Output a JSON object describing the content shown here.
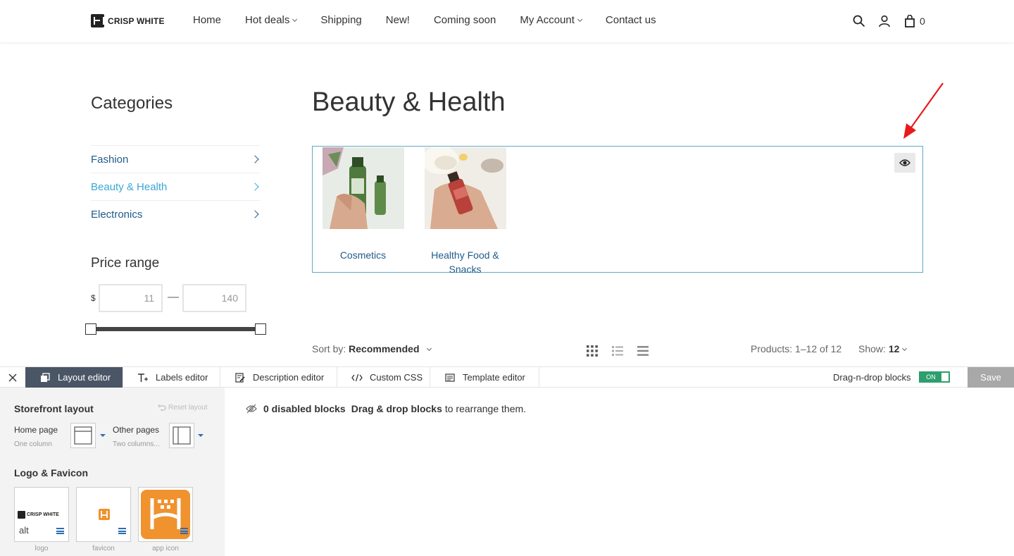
{
  "header": {
    "logo_text": "CRISP WHITE",
    "nav": [
      {
        "label": "Home",
        "dropdown": false
      },
      {
        "label": "Hot deals",
        "dropdown": true
      },
      {
        "label": "Shipping",
        "dropdown": false
      },
      {
        "label": "New!",
        "dropdown": false
      },
      {
        "label": "Coming soon",
        "dropdown": false
      },
      {
        "label": "My Account",
        "dropdown": true
      },
      {
        "label": "Contact us",
        "dropdown": false
      }
    ],
    "cart_count": "0"
  },
  "sidebar": {
    "categories_title": "Categories",
    "categories": [
      {
        "label": "Fashion",
        "active": false
      },
      {
        "label": "Beauty & Health",
        "active": true
      },
      {
        "label": "Electronics",
        "active": false
      }
    ],
    "price_title": "Price range",
    "currency": "$",
    "price_min": "11",
    "price_max": "140",
    "dash": "—"
  },
  "main": {
    "title": "Beauty & Health",
    "subcategories": [
      {
        "label": "Cosmetics"
      },
      {
        "label": "Healthy Food & Snacks"
      }
    ],
    "sort_label": "Sort by:",
    "sort_value": "Recommended",
    "products_count": "Products: 1–12 of 12",
    "show_label": "Show:",
    "show_value": "12"
  },
  "editor": {
    "tabs": [
      {
        "label": "Layout editor",
        "icon": "layout-icon",
        "active": true
      },
      {
        "label": "Labels editor",
        "icon": "text-icon",
        "active": false
      },
      {
        "label": "Description editor",
        "icon": "edit-icon",
        "active": false
      },
      {
        "label": "Custom CSS",
        "icon": "code-icon",
        "active": false
      },
      {
        "label": "Template editor",
        "icon": "template-icon",
        "active": false
      }
    ],
    "dnd_label": "Drag-n-drop blocks",
    "toggle_label": "ON",
    "save_label": "Save",
    "panel": {
      "storefront_title": "Storefront layout",
      "reset_label": "Reset layout",
      "home_label": "Home page",
      "home_sub": "One column",
      "other_label": "Other pages",
      "other_sub": "Two columns...",
      "logo_title": "Logo & Favicon",
      "logo_card_text": "CRISP WHITE",
      "logo_alt": "alt",
      "card_labels": [
        "logo",
        "favicon",
        "app icon"
      ]
    },
    "info": {
      "disabled": "0 disabled blocks",
      "drag": "Drag & drop blocks",
      "rest": "to rearrange them."
    }
  },
  "colors": {
    "link": "#1f5b8a",
    "active_link": "#3aa7d6",
    "box_border": "#5faac4",
    "active_tab": "#4a5566",
    "toggle_green": "#2e9e6e",
    "app_icon_orange": "#f0922e",
    "arrow_red": "#e8191b"
  }
}
